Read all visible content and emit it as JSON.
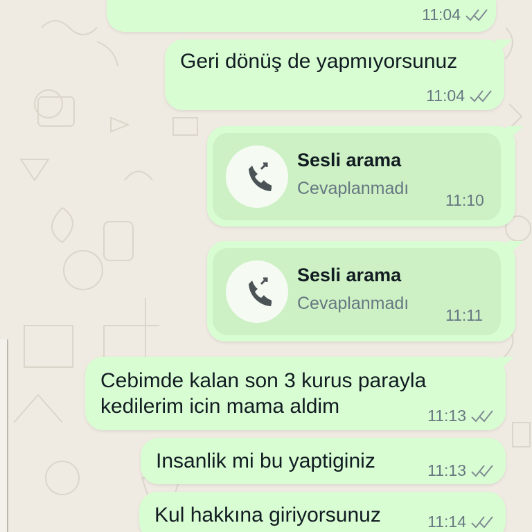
{
  "messages": [
    {
      "text": "",
      "time": "11:04",
      "status": "read"
    },
    {
      "text": "Geri dönüş de yapmıyorsunuz",
      "time": "11:04",
      "status": "read"
    },
    {
      "type": "call",
      "title": "Sesli arama",
      "subtitle": "Cevaplanmadı",
      "time": "11:10",
      "icon": "outgoing-call-icon"
    },
    {
      "type": "call",
      "title": "Sesli arama",
      "subtitle": "Cevaplanmadı",
      "time": "11:11",
      "icon": "outgoing-call-icon"
    },
    {
      "text_lines": [
        "Cebimde kalan son 3 kurus parayla",
        "kedilerim icin mama aldim"
      ],
      "time": "11:13",
      "status": "read"
    },
    {
      "text": "Insanlik mi bu yaptiginiz",
      "time": "11:13",
      "status": "read"
    },
    {
      "text": "Kul hakkına giriyorsunuz",
      "time": "11:14",
      "status": "read"
    }
  ],
  "colors": {
    "background": "#efeae2",
    "outgoing_bubble": "#d9fdd3",
    "call_panel": "#cdf1c5",
    "meta": "#667781",
    "text": "#111b21"
  }
}
